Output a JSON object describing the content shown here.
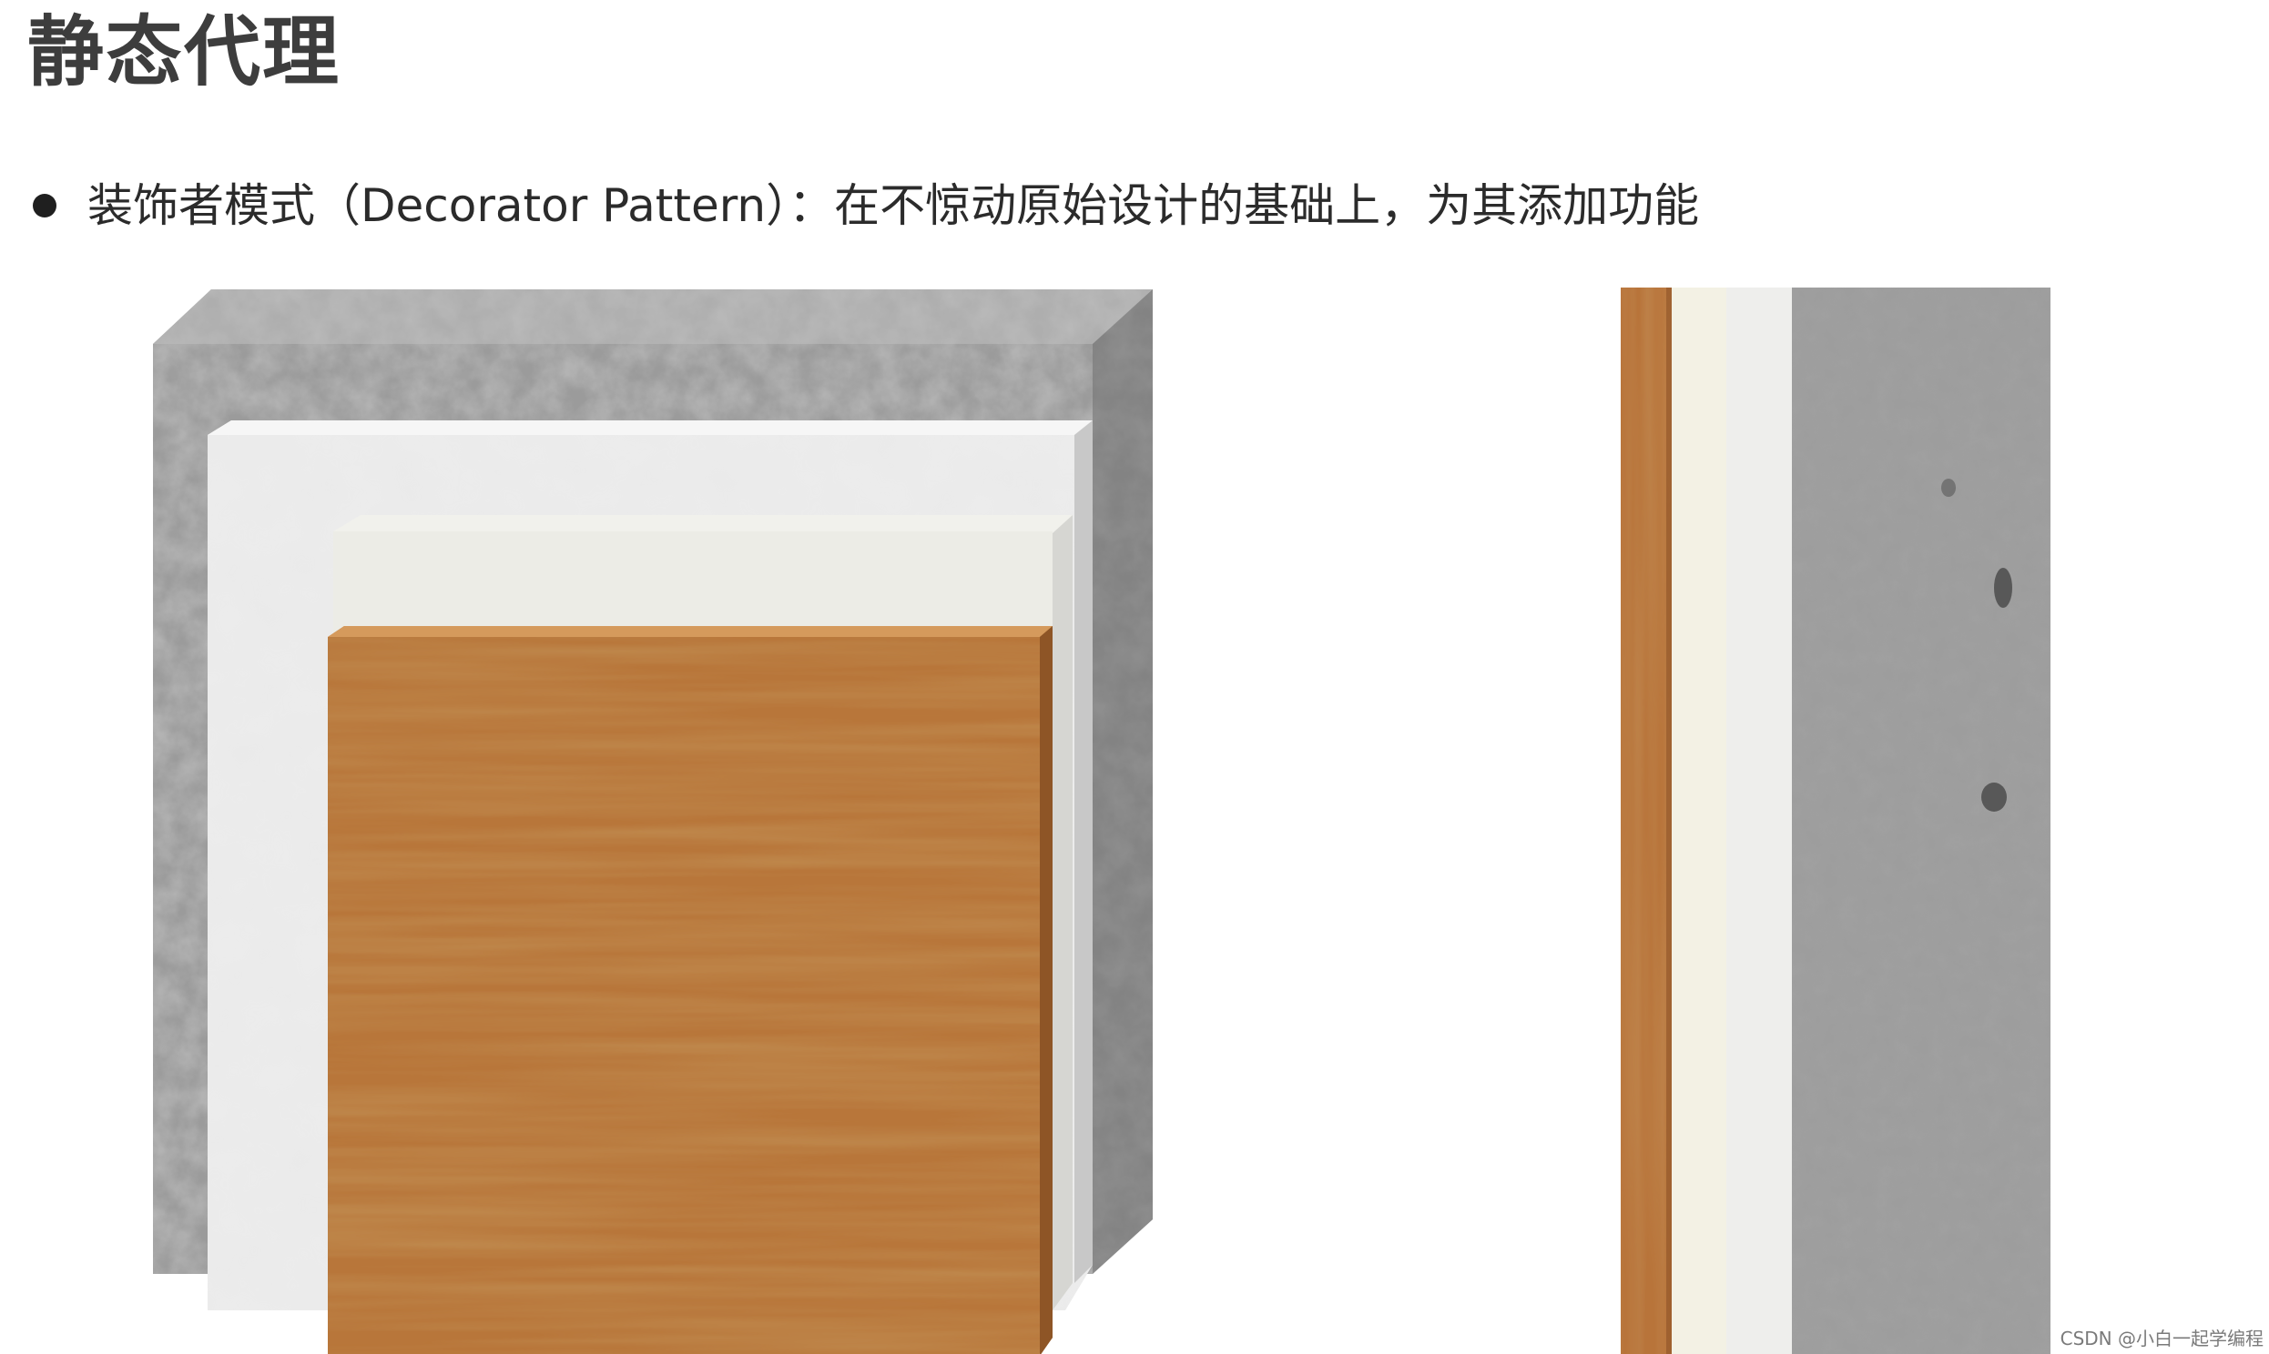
{
  "slide": {
    "title": "静态代理",
    "bullet": "装饰者模式（Decorator Pattern）：在不惊动原始设计的基础上，为其添加功能",
    "watermark": "CSDN @小白一起学编程"
  },
  "illustrations": {
    "left": {
      "description_icon": "layered-wall-3d-icon",
      "layers": [
        "concrete",
        "white-putty",
        "white-paint",
        "wood-panel"
      ]
    },
    "right": {
      "description_icon": "wall-cross-section-icon",
      "layers": [
        "wood-panel",
        "white-paint",
        "white-putty",
        "concrete"
      ]
    }
  },
  "colors": {
    "title": "#3d3d3d",
    "text": "#2b2b2b",
    "concrete": "#9a9a9a",
    "wood": "#b8783c",
    "paint": "#f2f2ee",
    "putty": "#e9e9e9"
  }
}
